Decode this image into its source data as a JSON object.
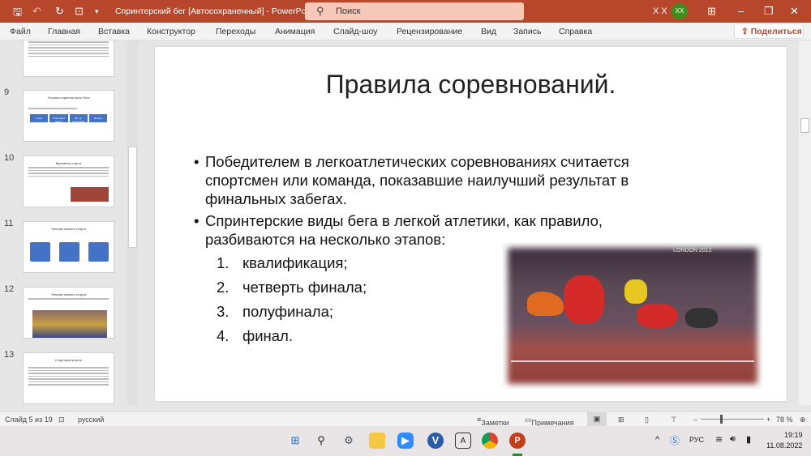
{
  "titlebar": {
    "doc_title": "Спринтерский бег [Автосохраненный]  -  PowerPoint",
    "search_placeholder": "Поиск",
    "user_name": "X X",
    "avatar_initials": "XX"
  },
  "ribbon": {
    "tabs": [
      "Файл",
      "Главная",
      "Вставка",
      "Конструктор",
      "Переходы",
      "Анимация",
      "Слайд-шоу",
      "Рецензирование",
      "Вид",
      "Запись",
      "Справка"
    ],
    "share_label": "Поделиться"
  },
  "thumbnails": [
    {
      "num": "9",
      "title": "Техника спринтерского бега",
      "steps": [
        "Старт",
        "Стартовый разгон",
        "Бег по дистанции",
        "Финиш"
      ]
    },
    {
      "num": "10",
      "title": "Варианты старта"
    },
    {
      "num": "11",
      "title": "Техника низкого старта"
    },
    {
      "num": "12",
      "title": "Техника низкого старта"
    },
    {
      "num": "13",
      "title": "Стартовый разгон"
    }
  ],
  "slide": {
    "title": "Правила соревнований.",
    "bullets": [
      "Победителем в легкоатлетических соревнованиях считается спортсмен или команда, показавшие наилучший результат в финальных забегах.",
      "Спринтерские виды бега в легкой атлетики, как правило, разбиваются на несколько этапов:"
    ],
    "list": [
      {
        "n": "1.",
        "t": "квалификация;"
      },
      {
        "n": "2.",
        "t": "четверть финала;"
      },
      {
        "n": "3.",
        "t": "полуфинала;"
      },
      {
        "n": "4.",
        "t": "финал."
      }
    ],
    "photo_banner": "LONDON 2012"
  },
  "status": {
    "slide_info": "Слайд 5 из 19",
    "language": "русский",
    "notes": "Заметки",
    "comments": "Примечания",
    "zoom": "78 %",
    "zoom_percent": 78
  },
  "taskbar": {
    "lang": "РУС",
    "time": "19:19",
    "date": "11.08.2022"
  },
  "colors": {
    "accent": "#b7472a",
    "thumb_shapes": "#4472c4"
  }
}
